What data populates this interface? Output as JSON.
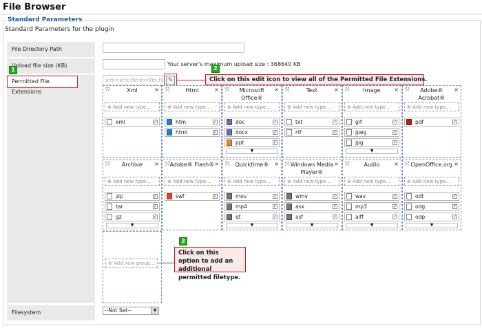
{
  "page": {
    "title": "File Browser"
  },
  "section": {
    "legend": "Standard Parameters",
    "description": "Standard Parameters for the plugin"
  },
  "fields": {
    "file_directory_path": {
      "label": "File Directory Path",
      "value": ""
    },
    "upload_file_size": {
      "label": "Upload file size (KB)",
      "value": "",
      "hint": "Your server's maximum upload size : 368640 KB"
    },
    "permitted_file_extensions": {
      "label": "Permitted File Extensions",
      "value": "xml=xml;html=htm,htm"
    },
    "filesystem": {
      "label": "Filesystem",
      "selected": "--Not Set--"
    }
  },
  "callouts": [
    {
      "num": "1",
      "text": ""
    },
    {
      "num": "2",
      "text": "Click on this edit icon to view all of the Permitted File Extensions."
    },
    {
      "num": "3",
      "text": "Click on this option to add an additional permitted filetype."
    }
  ],
  "add_type_label": "Add new type...",
  "add_group_label": "Add new group...",
  "groups_row1": [
    {
      "title": "Xml",
      "items": [
        {
          "name": "xml",
          "icon": "xml-file-icon"
        }
      ]
    },
    {
      "title": "Html",
      "items": [
        {
          "name": "htm",
          "icon": "htm-file-icon"
        },
        {
          "name": "html",
          "icon": "html-file-icon"
        }
      ]
    },
    {
      "title": "Microsoft Office®",
      "items": [
        {
          "name": "doc",
          "icon": "doc-file-icon"
        },
        {
          "name": "docx",
          "icon": "docx-file-icon"
        },
        {
          "name": "ppt",
          "icon": "ppt-file-icon"
        }
      ]
    },
    {
      "title": "Text",
      "items": [
        {
          "name": "txt",
          "icon": "txt-file-icon"
        },
        {
          "name": "rtf",
          "icon": "rtf-file-icon"
        }
      ]
    },
    {
      "title": "Image",
      "items": [
        {
          "name": "gif",
          "icon": "gif-file-icon"
        },
        {
          "name": "jpeg",
          "icon": "jpeg-file-icon"
        },
        {
          "name": "jpg",
          "icon": "jpg-file-icon"
        }
      ]
    },
    {
      "title": "Adobe® Acrobat®",
      "items": [
        {
          "name": "pdf",
          "icon": "pdf-file-icon"
        }
      ]
    }
  ],
  "groups_row2": [
    {
      "title": "Archive",
      "items": [
        {
          "name": "zip",
          "icon": "zip-file-icon"
        },
        {
          "name": "tar",
          "icon": "tar-file-icon"
        },
        {
          "name": "gz",
          "icon": "gz-file-icon"
        }
      ]
    },
    {
      "title": "Adobe® Flash®",
      "items": [
        {
          "name": "swf",
          "icon": "swf-file-icon"
        }
      ]
    },
    {
      "title": "Quicktime®",
      "items": [
        {
          "name": "mov",
          "icon": "mov-file-icon"
        },
        {
          "name": "mp4",
          "icon": "mp4-file-icon"
        },
        {
          "name": "qt",
          "icon": "qt-file-icon"
        }
      ]
    },
    {
      "title": "Windows Media Player®",
      "items": [
        {
          "name": "wmv",
          "icon": "wmv-file-icon"
        },
        {
          "name": "asx",
          "icon": "asx-file-icon"
        },
        {
          "name": "asf",
          "icon": "asf-file-icon"
        }
      ]
    },
    {
      "title": "Audio",
      "items": [
        {
          "name": "wav",
          "icon": "wav-file-icon"
        },
        {
          "name": "mp3",
          "icon": "mp3-file-icon"
        },
        {
          "name": "aiff",
          "icon": "aiff-file-icon"
        }
      ]
    },
    {
      "title": "OpenOffice.org",
      "items": [
        {
          "name": "odt",
          "icon": "odt-file-icon"
        },
        {
          "name": "odg",
          "icon": "odg-file-icon"
        },
        {
          "name": "odp",
          "icon": "odp-file-icon"
        }
      ]
    }
  ]
}
